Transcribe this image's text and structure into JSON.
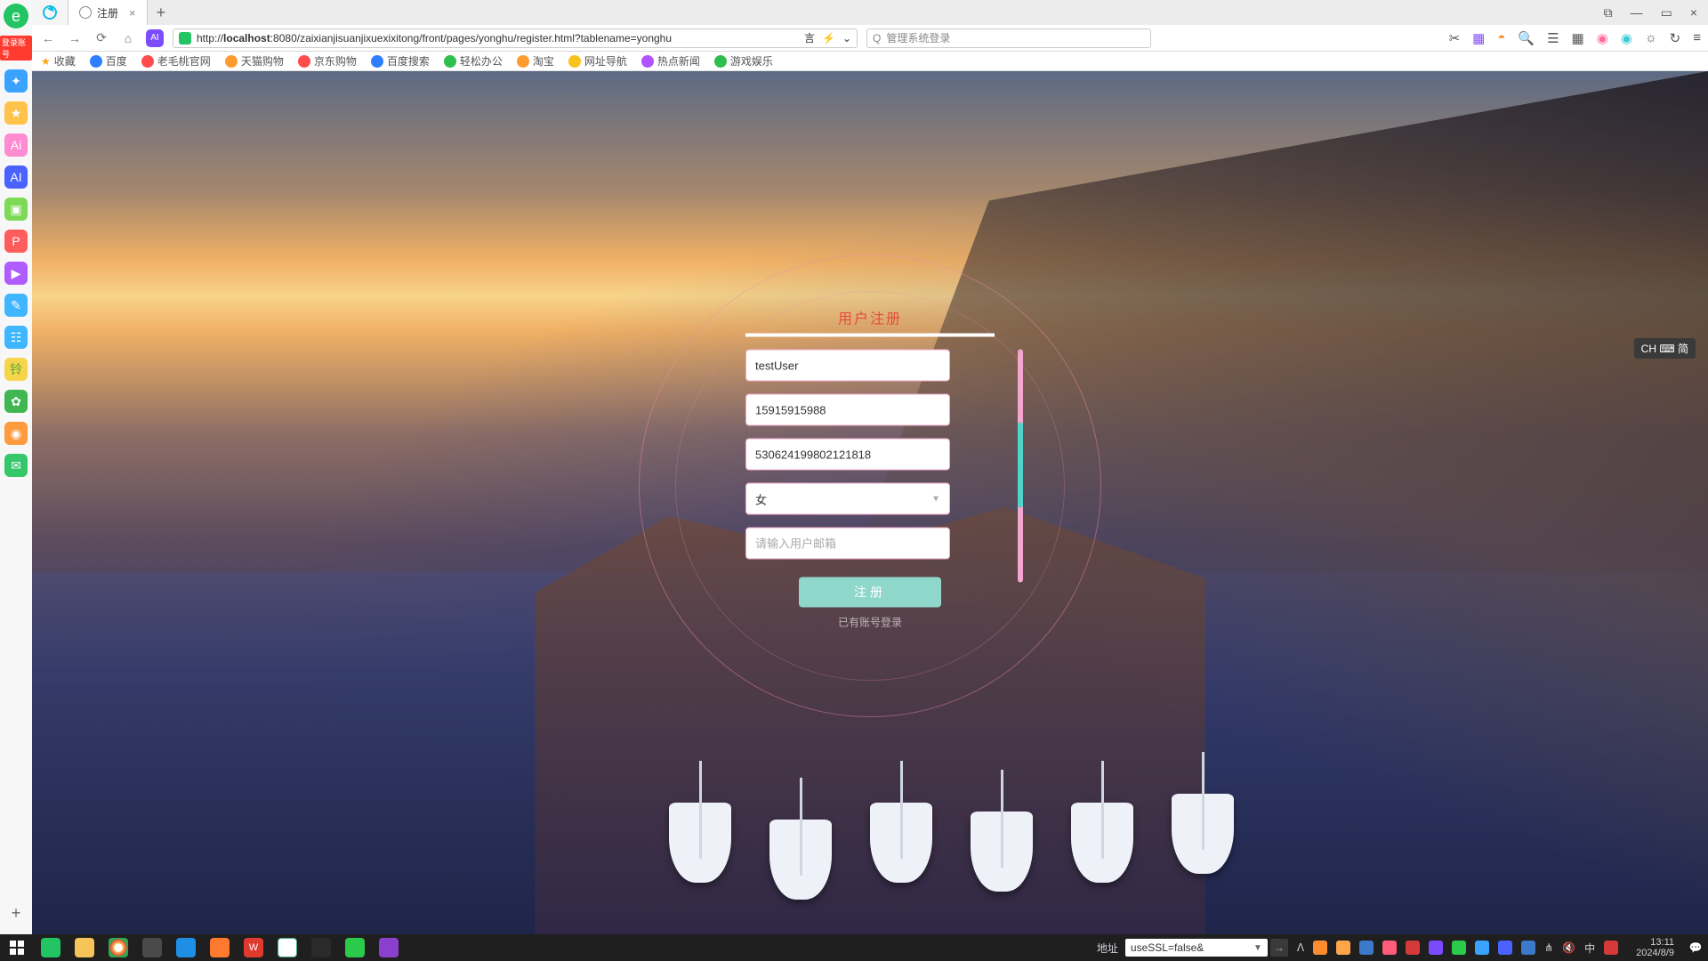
{
  "os_sidebar": {
    "login_badge": "登录账号"
  },
  "titlebar": {
    "tab1": "",
    "tab2": "注册",
    "close_glyph": "×",
    "plus_glyph": "+",
    "win_box": "▭",
    "win_min": "—",
    "win_close": "×",
    "win_ext": "⧉"
  },
  "urlbar": {
    "back": "←",
    "fwd": "→",
    "reload": "⟳",
    "home": "⌂",
    "url_prefix": "http://",
    "url_host": "localhost",
    "url_rest": ":8080/zaixianjisuanjixuexixitong/front/pages/yonghu/register.html?tablename=yonghu",
    "translate": "言",
    "lightning": "⚡",
    "dd": "⌄",
    "search_icon": "Q",
    "search_placeholder": "管理系统登录",
    "tool_scissor": "✂",
    "tool_cube": "▦",
    "tool_shield": "◓",
    "tool_zoom": "🔍",
    "tool_panel": "☰",
    "tool_grid": "▦",
    "tool_ring1": "◉",
    "tool_ring2": "◉",
    "tool_sun": "☼",
    "tool_refresh_dd": "↻",
    "tool_menu": "≡"
  },
  "bookmarks": {
    "fav": "收藏",
    "items": [
      "百度",
      "老毛桃官网",
      "天猫购物",
      "京东购物",
      "百度搜索",
      "轻松办公",
      "淘宝",
      "网址导航",
      "热点新闻",
      "游戏娱乐"
    ]
  },
  "ime_badge": "CH ⌨ 简",
  "register": {
    "title": "用户注册",
    "username": "testUser",
    "phone": "15915915988",
    "idcard": "530624199802121818",
    "gender_selected": "女",
    "email_value": "",
    "email_placeholder": "请输入用户邮箱",
    "submit": "注册",
    "login_link": "已有账号登录"
  },
  "taskbar": {
    "addr_label": "地址",
    "addr_value": "useSSL=false&",
    "go": "→",
    "clock_time": "13:11",
    "clock_date": "2024/8/9",
    "ime": "中",
    "tray_up": "ᐱ"
  }
}
